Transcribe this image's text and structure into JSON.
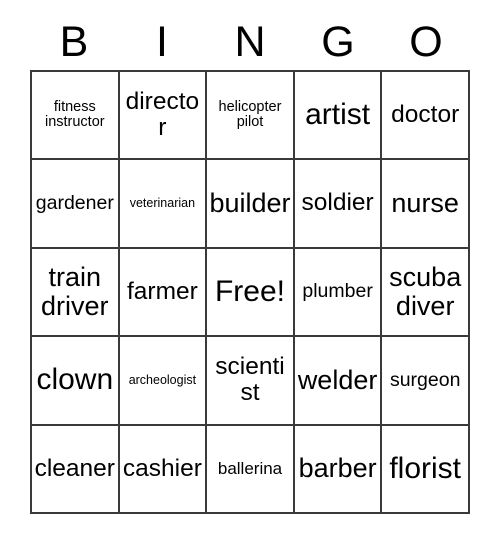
{
  "header": {
    "letters": [
      "B",
      "I",
      "N",
      "G",
      "O"
    ]
  },
  "grid": {
    "columns": 5,
    "rows": 5,
    "border_color": "#3a3a3a",
    "background_color": "#ffffff",
    "text_color": "#000000",
    "cells": [
      {
        "label": "fitness instructor",
        "size": "xs",
        "free": false
      },
      {
        "label": "director",
        "size": "xl",
        "free": false
      },
      {
        "label": "helicopter pilot",
        "size": "xs",
        "free": false
      },
      {
        "label": "artist",
        "size": "huge",
        "free": false
      },
      {
        "label": "doctor",
        "size": "xl",
        "free": false
      },
      {
        "label": "gardener",
        "size": "md",
        "free": false
      },
      {
        "label": "veterinarian",
        "size": "xxs",
        "free": false
      },
      {
        "label": "builder",
        "size": "xxl",
        "free": false
      },
      {
        "label": "soldier",
        "size": "xl",
        "free": false
      },
      {
        "label": "nurse",
        "size": "xxl",
        "free": false
      },
      {
        "label": "train driver",
        "size": "xxl",
        "free": false
      },
      {
        "label": "farmer",
        "size": "xl",
        "free": false
      },
      {
        "label": "Free!",
        "size": "huge",
        "free": true
      },
      {
        "label": "plumber",
        "size": "md",
        "free": false
      },
      {
        "label": "scuba diver",
        "size": "xxl",
        "free": false
      },
      {
        "label": "clown",
        "size": "huge",
        "free": false
      },
      {
        "label": "archeologist",
        "size": "xxs",
        "free": false
      },
      {
        "label": "scientist",
        "size": "xl",
        "free": false
      },
      {
        "label": "welder",
        "size": "xxl",
        "free": false
      },
      {
        "label": "surgeon",
        "size": "md",
        "free": false
      },
      {
        "label": "cleaner",
        "size": "xl",
        "free": false
      },
      {
        "label": "cashier",
        "size": "xl",
        "free": false
      },
      {
        "label": "ballerina",
        "size": "sm",
        "free": false
      },
      {
        "label": "barber",
        "size": "xxl",
        "free": false
      },
      {
        "label": "florist",
        "size": "huge",
        "free": false
      }
    ]
  }
}
